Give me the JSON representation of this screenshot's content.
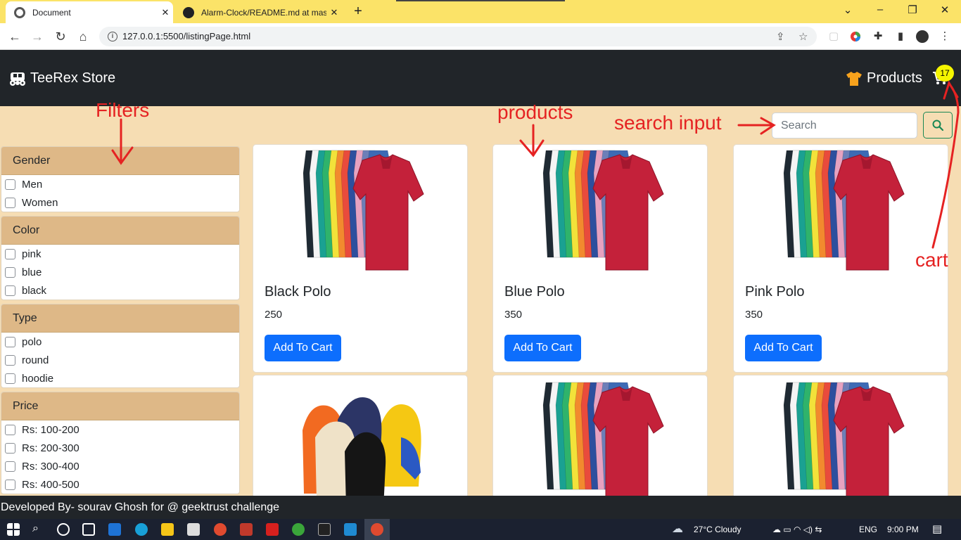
{
  "browser": {
    "tabs": [
      {
        "title": "Document",
        "active": true
      },
      {
        "title": "Alarm-Clock/README.md at mas",
        "active": false
      }
    ],
    "url": "127.0.0.1:5500/listingPage.html"
  },
  "navbar": {
    "brand": "TeeRex Store",
    "products_label": "Products",
    "cart_count": "17"
  },
  "search": {
    "placeholder": "Search"
  },
  "filters": [
    {
      "title": "Gender",
      "options": [
        "Men",
        "Women"
      ]
    },
    {
      "title": "Color",
      "options": [
        "pink",
        "blue",
        "black"
      ]
    },
    {
      "title": "Type",
      "options": [
        "polo",
        "round",
        "hoodie"
      ]
    },
    {
      "title": "Price",
      "options": [
        "Rs: 100-200",
        "Rs: 200-300",
        "Rs: 300-400",
        "Rs: 400-500"
      ]
    }
  ],
  "products": [
    {
      "name": "Black Polo",
      "price": "250",
      "button": "Add To Cart",
      "image": "polo-shirts"
    },
    {
      "name": "Blue Polo",
      "price": "350",
      "button": "Add To Cart",
      "image": "polo-shirts"
    },
    {
      "name": "Pink Polo",
      "price": "350",
      "button": "Add To Cart",
      "image": "polo-shirts"
    },
    {
      "name": "",
      "price": "",
      "button": "",
      "image": "hoodies"
    },
    {
      "name": "",
      "price": "",
      "button": "",
      "image": "polo-shirts"
    },
    {
      "name": "",
      "price": "",
      "button": "",
      "image": "polo-shirts"
    }
  ],
  "annotations": {
    "filters": "Filters",
    "products": "products",
    "search_input": "search input",
    "cart": "cart",
    "color": "#e52222"
  },
  "footer": {
    "text": "Developed By- sourav Ghosh for @ geektrust challenge"
  },
  "taskbar": {
    "weather": "27°C  Cloudy",
    "language": "ENG",
    "time": "9:00 PM"
  }
}
